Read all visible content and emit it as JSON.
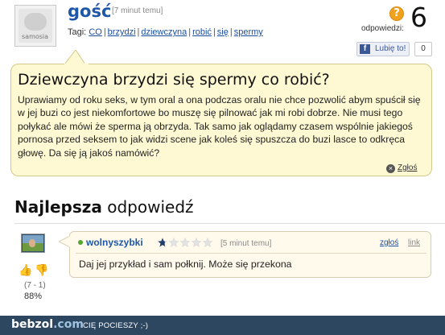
{
  "header": {
    "username": "gość",
    "time": "[7 minut temu]",
    "tags_label": "Tagi:",
    "tags": [
      "CO",
      "brzydzi",
      "dziewczyna",
      "robić",
      "się",
      "spermy"
    ],
    "tag_separator": "|",
    "avatar_logo": "samosia",
    "answers_icon": "?",
    "answers_label": "odpowiedzi:",
    "answers_count": "6",
    "like_label": "Lubię to!",
    "like_icon": "f",
    "like_count": "0"
  },
  "question": {
    "title": "Dziewczyna brzydzi się spermy co robić?",
    "body": "Uprawiamy od roku seks, w tym oral a ona podczas oralu nie chce pozwolić abym spuścił się w jej buzi co jest niekomfortowe bo muszę się pilnować jak mi robi dobrze. Nie musi tego połykać ale mówi że sperma ją obrzyda. Tak samo jak oglądamy czasem wspólnie jakiegoś pornosa przed seksem to jak widzi scene jak koleś się spuszcza do buzi lasce to odkręca głowę. Da się ją jakoś namówić?",
    "report_icon": "×",
    "report_label": "Zgłoś"
  },
  "best_answer": {
    "heading_bold": "Najlepsza",
    "heading_rest": "odpowiedź",
    "user": "wolnyszybki",
    "rank_level": 0.14,
    "time": "[5 minut temu]",
    "report_label": "zgłoś",
    "link_label": "link",
    "text": "Daj jej przykład i sam połknij. Może się przekona",
    "votes": {
      "up_icon": "👍",
      "down_icon": "👎",
      "detail": "(7 - 1)",
      "percent": "88%"
    }
  },
  "footer": {
    "logo_main": "bebzol",
    "logo_dom": ".com",
    "tagline": "CIĘ POCIESZY ;-)"
  },
  "colors": {
    "username": "#1f57a8",
    "link": "#1a4fa0",
    "question_bg": "#fff9d3",
    "answer_bg": "#fffaec",
    "footer_bg": "#2d4761",
    "answers_icon": "#f0a11e",
    "online": "#55a632"
  }
}
